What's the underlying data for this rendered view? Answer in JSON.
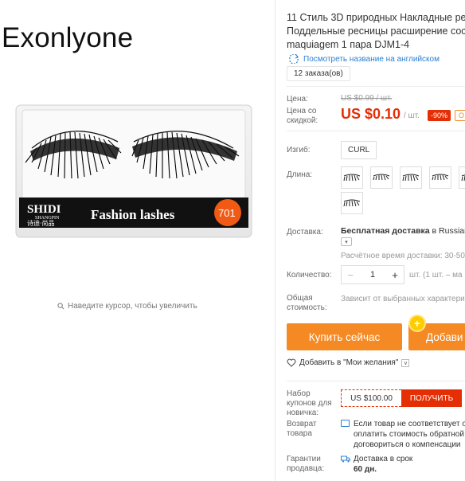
{
  "brand": "Exonlyone",
  "product_image": {
    "box_brand_line1": "SHIDI",
    "box_brand_line2": "SHANGPIN",
    "box_brand_cn": "诗迪·尚品",
    "box_caption": "Fashion lashes",
    "box_number": "701"
  },
  "zoom_hint": "Наведите курсор, чтобы увеличить",
  "title_lines": [
    "11 Стиль 3D природных Накладные рес",
    "Поддельные ресницы расширение сос",
    "maquiagem 1 пара DJM1-4"
  ],
  "view_english": "Посмотреть название на английском",
  "orders": "12 заказа(ов)",
  "price": {
    "label_price": "Цена:",
    "old_price": "US $0.99 / шт.",
    "label_discount_line1": "Цена со",
    "label_discount_line2": "скидкой:",
    "current_price": "US $0.10",
    "per_unit": "/ шт.",
    "discount_badge": "-90%",
    "extra_badge": "О"
  },
  "curl": {
    "label": "Изгиб:",
    "option": "CURL"
  },
  "length": {
    "label": "Длина:",
    "thumb_count": 6
  },
  "shipping": {
    "label": "Доставка:",
    "text_bold": "Бесплатная доставка",
    "text_rest": " в Russian",
    "estimate": "Расчётное время доставки: 30-50"
  },
  "quantity": {
    "label": "Количество:",
    "minus": "−",
    "value": "1",
    "plus": "+",
    "info": "шт. (1 шт. – ма"
  },
  "total": {
    "label_line1": "Общая",
    "label_line2": "стоимость:",
    "value": "Зависит от выбранных характери"
  },
  "buttons": {
    "buy_now": "Купить сейчас",
    "add_to_cart": "Добави",
    "cart_badge": "+"
  },
  "wishlist": {
    "label": "Добавить в \"Мои желания\"",
    "arrow": "∨"
  },
  "coupon": {
    "label_lines": [
      "Набор",
      "купонов для",
      "новичка:"
    ],
    "value": "US $100.00",
    "get_label": "ПОЛУЧИТЬ"
  },
  "returns": {
    "label_lines": [
      "Возврат",
      "товара"
    ],
    "lines": [
      "Если товар не соответствует оп",
      "оплатить стоимость обратной",
      "договориться о компенсации"
    ]
  },
  "guarantee": {
    "label_lines": [
      "Гарантии",
      "продавца:"
    ],
    "line1": "Доставка в срок",
    "line2": "60 дн."
  },
  "colors": {
    "accent_orange": "#f58a24",
    "price_red": "#e62e04",
    "link_blue": "#2a7fd4"
  }
}
